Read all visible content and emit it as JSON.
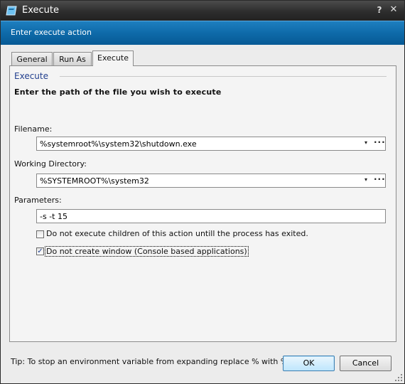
{
  "window": {
    "title": "Execute",
    "help_glyph": "?",
    "close_glyph": "✕"
  },
  "banner": {
    "text": "Enter execute action"
  },
  "tabs": [
    {
      "label": "General",
      "active": false
    },
    {
      "label": "Run As",
      "active": false
    },
    {
      "label": "Execute",
      "active": true
    }
  ],
  "section": {
    "title": "Execute",
    "description": "Enter the path of the file you wish to execute"
  },
  "filename": {
    "label": "Filename:",
    "value": "%systemroot%\\system32\\shutdown.exe",
    "arrow": "▾",
    "browse": "···"
  },
  "working_directory": {
    "label": "Working Directory:",
    "value": "%SYSTEMROOT%\\system32",
    "arrow": "▾",
    "browse": "···"
  },
  "parameters": {
    "label": "Parameters:",
    "value": "-s -t 15"
  },
  "options": [
    {
      "label": "Do not execute children of this action untill the process has exited.",
      "checked": false,
      "check_glyph": ""
    },
    {
      "label": "Do not create window (Console based applications)",
      "checked": true,
      "check_glyph": "✓"
    }
  ],
  "tip": "Tip: To stop an environment variable from expanding replace % with %%.",
  "buttons": {
    "ok": "OK",
    "cancel": "Cancel"
  },
  "colors": {
    "banner": "#0e6aa9",
    "section_title": "#23408e",
    "titlebar": "#2d2d2d"
  }
}
